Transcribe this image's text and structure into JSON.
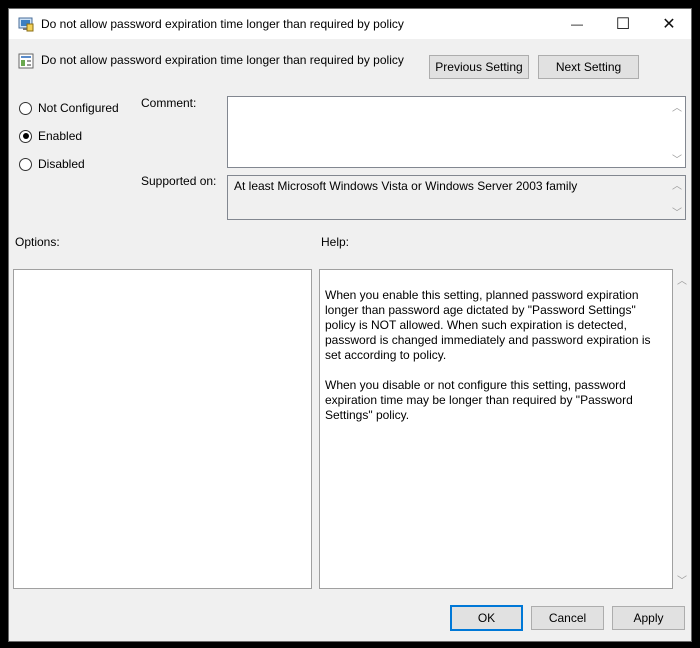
{
  "window": {
    "title": "Do not allow password expiration time longer than required by policy",
    "controls": {
      "minimize": "—",
      "maximize": "☐",
      "close": "✕"
    }
  },
  "header": {
    "setting_name": "Do not allow password expiration time longer than required by policy",
    "prev_label": "Previous Setting",
    "next_label": "Next Setting"
  },
  "state": {
    "options": [
      {
        "label": "Not Configured",
        "checked": false
      },
      {
        "label": "Enabled",
        "checked": true
      },
      {
        "label": "Disabled",
        "checked": false
      }
    ]
  },
  "comment": {
    "label": "Comment:",
    "value": ""
  },
  "supported": {
    "label": "Supported on:",
    "value": "At least Microsoft Windows Vista or Windows Server 2003 family"
  },
  "options_pane": {
    "label": "Options:"
  },
  "help_pane": {
    "label": "Help:",
    "paragraphs": [
      "When you enable this setting, planned password expiration longer than password age dictated by \"Password Settings\" policy is NOT allowed. When such expiration is detected, password is changed immediately and password expiration is set according to policy.",
      "When you disable or not configure this setting, password expiration time may be longer than required by \"Password Settings\" policy."
    ]
  },
  "footer": {
    "ok_label": "OK",
    "cancel_label": "Cancel",
    "apply_label": "Apply"
  }
}
